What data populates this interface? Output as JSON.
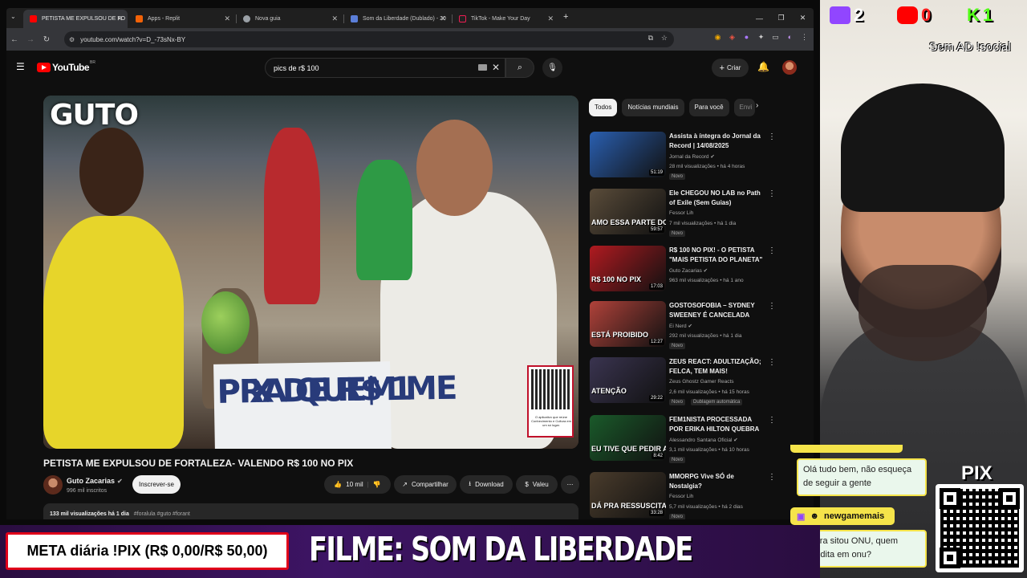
{
  "browser": {
    "tabs": [
      {
        "title": "PETISTA ME EXPULSOU DE FO",
        "fav_color": "#ff0000",
        "active": true
      },
      {
        "title": "Apps - Replit",
        "fav_color": "#f26207",
        "active": false
      },
      {
        "title": "Nova guia",
        "fav_color": "#9aa0a6",
        "active": false
      },
      {
        "title": "Som da Liberdade (Dublado) - 20",
        "fav_color": "#5b7ed8",
        "active": false
      },
      {
        "title": "TikTok - Make Your Day",
        "fav_color": "#222222",
        "active": false
      }
    ],
    "new_tab": "+",
    "url": "youtube.com/watch?v=D_-73sNx-BY"
  },
  "youtube": {
    "logo_text": "YouTube",
    "country": "BR",
    "search_value": "pics de r$ 100",
    "create_label": "Criar",
    "video_title": "PETISTA ME EXPULSOU DE FORTALEZA- VALENDO R$ 100 NO PIX",
    "channel_name": "Guto Zacarias",
    "channel_subs": "996 mil inscritos",
    "subscribe_label": "Inscrever-se",
    "likes": "10 mil",
    "share_label": "Compartilhar",
    "download_label": "Download",
    "thanks_label": "Valeu",
    "desc_views": "133 mil visualizações  há 1 dia",
    "desc_tags": "#foralula #guto #forant",
    "watermark": "GUTO",
    "sign_line1": "PIX DE R$ 1",
    "sign_line2": "PRA QUEM ME",
    "qr_caption": "O aplicativo que reúne Conhecimento e Cultura em um só lugar.",
    "chips": [
      "Todos",
      "Notícias mundiais",
      "Para você",
      "Envi"
    ],
    "recommendations": [
      {
        "title": "Assista à íntegra do Jornal da Record | 14/08/2025",
        "channel": "Jornal da Record",
        "verified": true,
        "meta": "28 mil visualizações • há 4 horas",
        "badge": "Novo",
        "badge2": "",
        "duration": "51:19",
        "overlay": "",
        "thumb_color": "#2a5fb0"
      },
      {
        "title": "Ele CHEGOU NO LAB no Path of Exile (Sem Guias)",
        "channel": "Fessor Lih",
        "verified": false,
        "meta": "7 mil visualizações • há 1 dia",
        "badge": "Novo",
        "badge2": "",
        "duration": "59:57",
        "overlay": "AMO ESSA PARTE DO POE",
        "thumb_color": "#5a4c3a"
      },
      {
        "title": "R$ 100 NO PIX! - O PETISTA \"MAIS PETISTA DO PLANETA\" ...",
        "channel": "Guto Zacarias",
        "verified": true,
        "meta": "963 mil visualizações • há 1 ano",
        "badge": "",
        "badge2": "",
        "duration": "17:03",
        "overlay": "R$ 100 NO PIX",
        "thumb_color": "#b01a20"
      },
      {
        "title": "GOSTOSOFOBIA – SYDNEY SWEENEY É CANCELADA",
        "channel": "Ei Nerd",
        "verified": true,
        "meta": "292 mil visualizações • há 1 dia",
        "badge": "Novo",
        "badge2": "",
        "duration": "12:27",
        "overlay": "ESTÁ PROIBIDO",
        "thumb_color": "#b0423a"
      },
      {
        "title": "ZEUS REACT: ADULTIZAÇÃO; FELCA, TEM MAIS!",
        "channel": "Zeus Ghostz Gamer Reacts",
        "verified": false,
        "meta": "2,6 mil visualizações • há 15 horas",
        "badge": "Novo",
        "badge2": "Dublagem automática",
        "duration": "29:22",
        "overlay": "ATENÇÃO",
        "thumb_color": "#3a3450"
      },
      {
        "title": "FEM1NISTA PROCESSADA POR ERIKA HILTON QUEBRA ...",
        "channel": "Alessandro Santana Oficial",
        "verified": true,
        "meta": "3,1 mil visualizações • há 10 horas",
        "badge": "Novo",
        "badge2": "",
        "duration": "8:42",
        "overlay": "EU TIVE QUE PEDIR ASILO",
        "thumb_color": "#1a5a2a"
      },
      {
        "title": "MMORPG Vive SÓ de Nostalgia?",
        "channel": "Fessor Lih",
        "verified": false,
        "meta": "5,7 mil visualizações • há 2 dias",
        "badge": "Novo",
        "badge2": "",
        "duration": "33:28",
        "overlay": "DÁ PRA RESSUSCITAR",
        "thumb_color": "#4a3c2c"
      }
    ]
  },
  "stream": {
    "twitch_count": "2",
    "youtube_count": "0",
    "kick_count": "1",
    "kick_letter": "K",
    "sem_ad": "Sem AD !social",
    "pix_label": "PIX",
    "chat": [
      {
        "user": "",
        "message": "Olá tudo bem, não esqueça de seguir a gente"
      },
      {
        "user": "newgamemais",
        "message": "o cara sitou ONU, quem acredita em onu?"
      }
    ],
    "meta_text": "META diária !PIX (R$ 0,00/R$ 50,00)",
    "filme_text": "FILME: SOM DA LIBERDADE"
  },
  "colors": {
    "yt_red": "#ff0000",
    "twitch": "#9146ff",
    "kick": "#53fc18",
    "chat_yellow": "#f5e44a",
    "meta_border": "#e0001a"
  }
}
